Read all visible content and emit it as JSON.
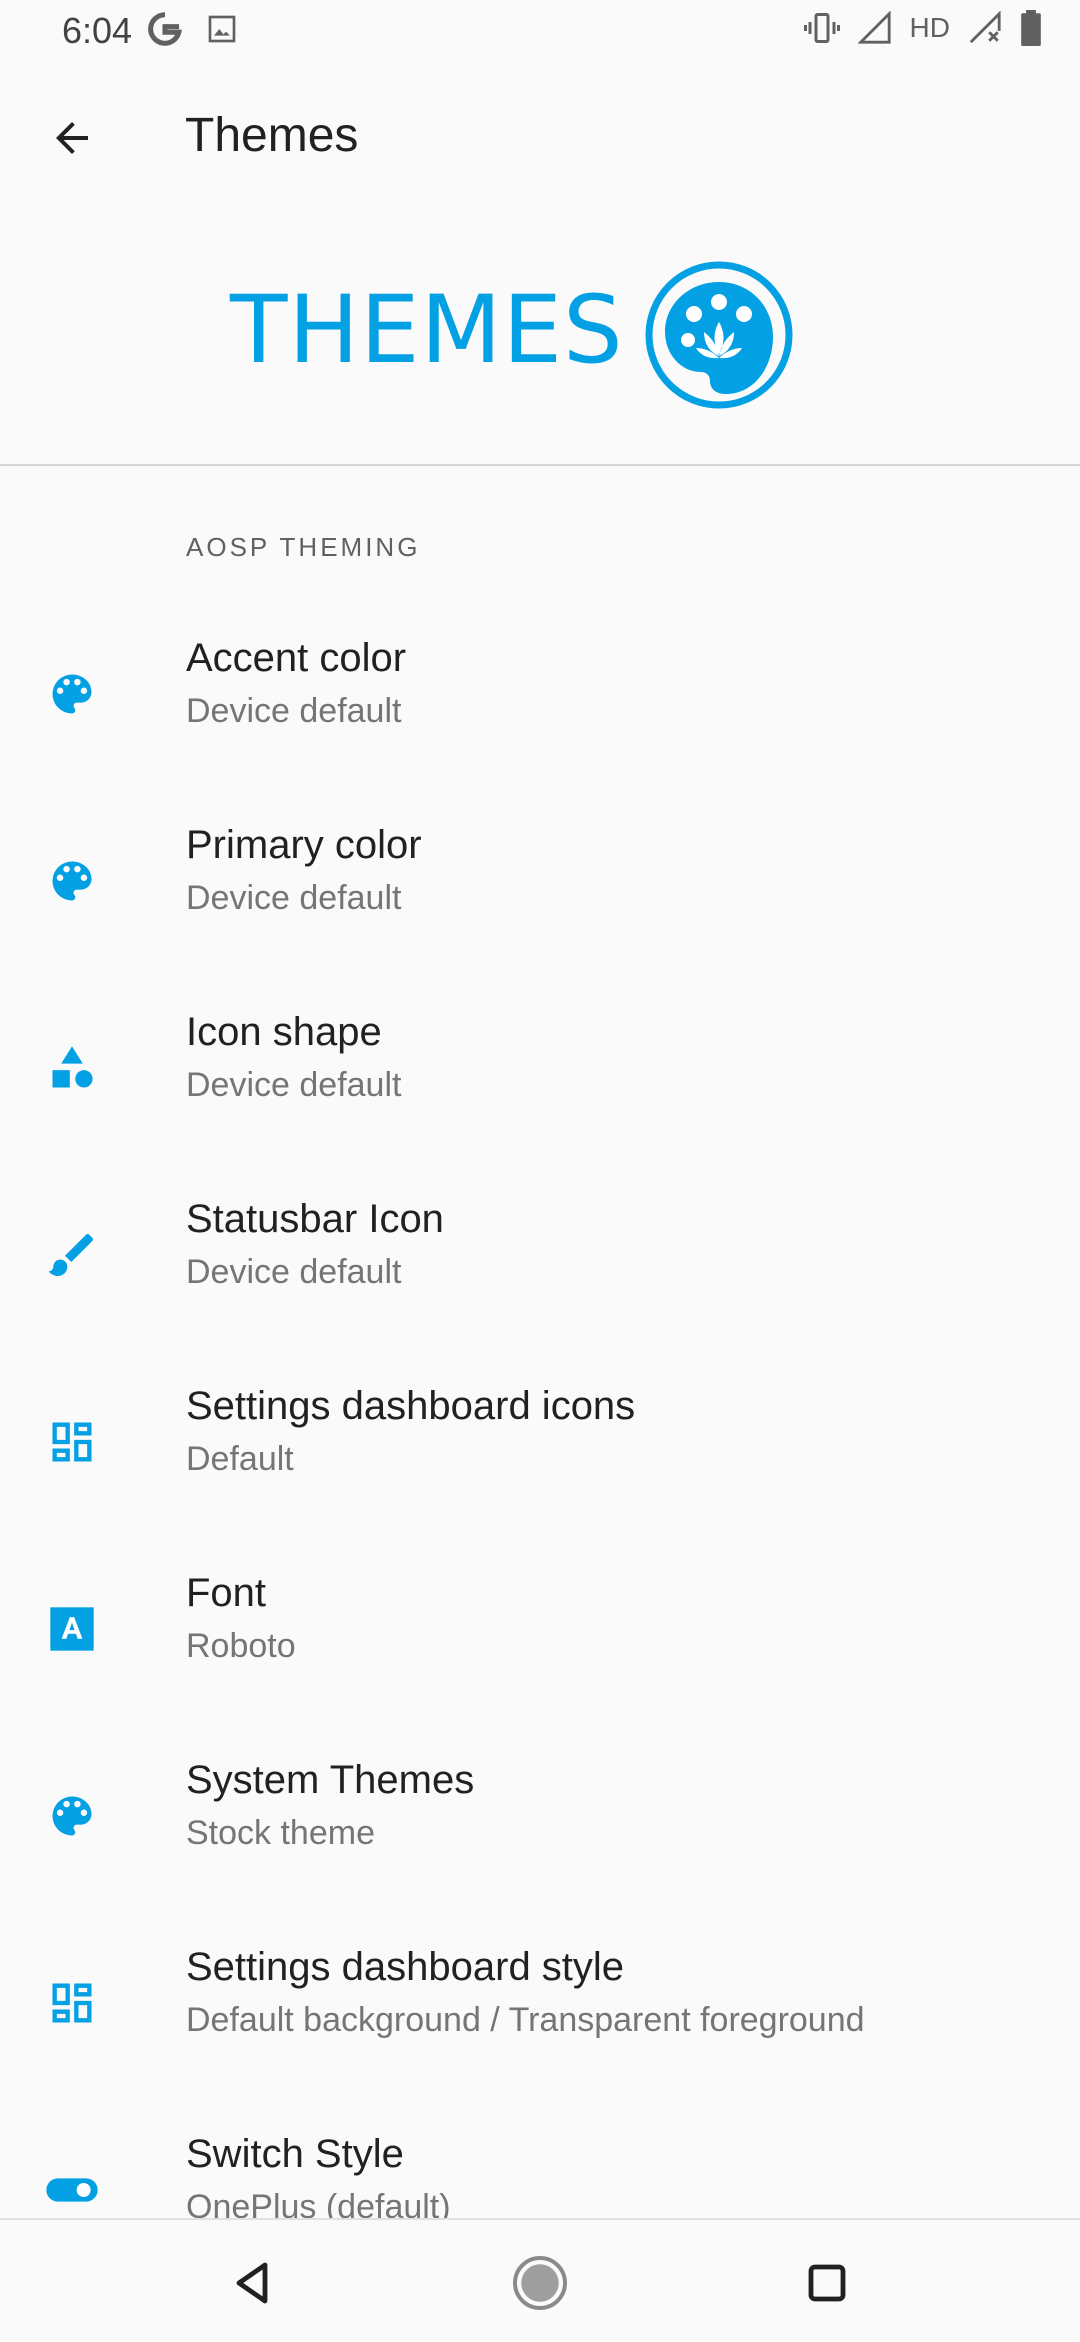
{
  "status_bar": {
    "time": "6:04",
    "hd": "HD",
    "icons": [
      "google-icon",
      "image-icon",
      "vibrate-icon",
      "signal-icon",
      "signal-x-icon",
      "battery-icon"
    ]
  },
  "app_bar": {
    "title": "Themes"
  },
  "banner": {
    "text": "THEMES"
  },
  "section": {
    "header": "AOSP THEMING"
  },
  "items": [
    {
      "title": "Accent color",
      "subtitle": "Device default",
      "icon": "palette-icon"
    },
    {
      "title": "Primary color",
      "subtitle": "Device default",
      "icon": "palette-icon"
    },
    {
      "title": "Icon shape",
      "subtitle": "Device default",
      "icon": "shapes-icon"
    },
    {
      "title": "Statusbar Icon",
      "subtitle": "Device default",
      "icon": "brush-icon"
    },
    {
      "title": "Settings dashboard icons",
      "subtitle": "Default",
      "icon": "dashboard-icon"
    },
    {
      "title": "Font",
      "subtitle": "Roboto",
      "icon": "font-icon"
    },
    {
      "title": "System Themes",
      "subtitle": "Stock theme",
      "icon": "palette-icon"
    },
    {
      "title": "Settings dashboard style",
      "subtitle": "Default background / Transparent foreground",
      "icon": "dashboard-icon"
    },
    {
      "title": "Switch Style",
      "subtitle": "OnePlus (default)",
      "icon": "toggle-icon"
    }
  ],
  "colors": {
    "accent": "#03a0e4",
    "text": "#212121",
    "subtext": "#757575"
  }
}
